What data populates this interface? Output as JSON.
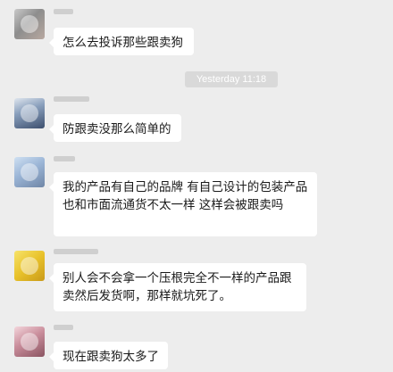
{
  "conversation": {
    "timestamp": "Yesterday 11:18",
    "messages": [
      {
        "text": "怎么去投诉那些跟卖狗"
      },
      {
        "text": "防跟卖没那么简单的"
      },
      {
        "text": "我的产品有自己的品牌  有自己设计的包装产品也和市面流通货不太一样  这样会被跟卖吗"
      },
      {
        "text": "别人会不会拿一个压根完全不一样的产品跟卖然后发货啊，那样就坑死了。"
      },
      {
        "text": "现在跟卖狗太多了"
      }
    ]
  }
}
